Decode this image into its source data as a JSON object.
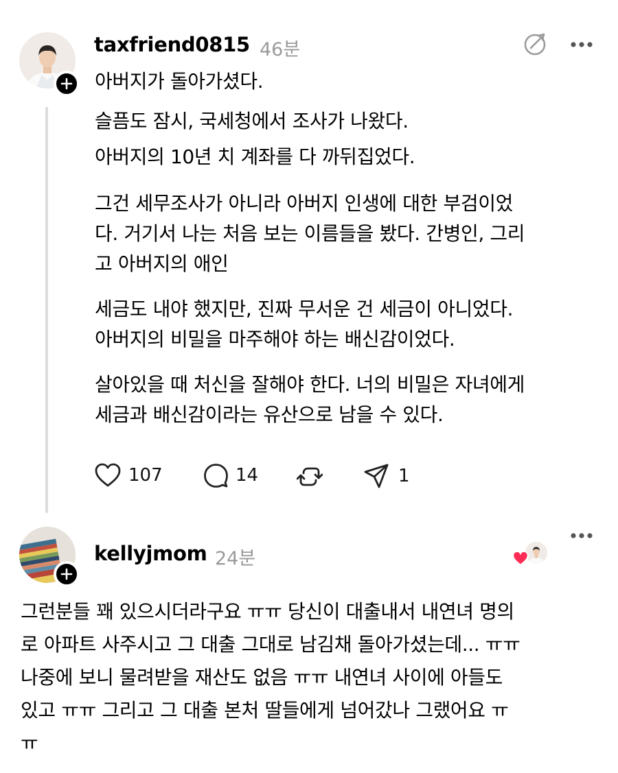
{
  "post": {
    "username": "taxfriend0815",
    "time": "46분",
    "lines_group1": [
      "아버지가 돌아가셨다.",
      "슬픔도 잠시, 국세청에서 조사가 나왔다.",
      "아버지의 10년 치 계좌를 다 까뒤집었다."
    ],
    "lines_group2": [
      "그건 세무조사가 아니라 아버지 인생에 대한 부검이었",
      "다. 거기서 나는 처음 보는 이름들을 봤다. 간병인, 그리",
      "고 아버지의 애인"
    ],
    "lines_group3": [
      "세금도 내야 했지만, 진짜 무서운 건 세금이 아니었다.",
      "아버지의 비밀을 마주해야 하는 배신감이었다."
    ],
    "lines_group4": [
      "살아있을 때 처신을 잘해야 한다. 너의 비밀은 자녀에게",
      "세금과 배신감이라는 유산으로 남을 수 있다."
    ],
    "likes": "107",
    "comments": "14",
    "shares": "1",
    "icons": {
      "translate": "translate-icon",
      "more": "more-icon",
      "like": "heart-icon",
      "comment": "comment-icon",
      "repost": "repost-icon",
      "share": "send-icon"
    }
  },
  "reply": {
    "username": "kellyjmom",
    "time": "24분",
    "lines": [
      "그런분들 꽤 있으시더라구요 ㅠㅠ 당신이 대출내서 내연녀 명의",
      "로 아파트 사주시고 그 대출 그대로 남김채 돌아가셨는데... ㅠㅠ",
      "나중에 보니 물려받을 재산도 없음 ㅠㅠ 내연녀 사이에 아들도",
      "있고 ㅠㅠ 그리고 그 대출 본처 딸들에게 넘어갔나 그랬어요 ㅠ",
      "ㅠ"
    ],
    "colors": {
      "heart": "#ff2d55"
    }
  }
}
